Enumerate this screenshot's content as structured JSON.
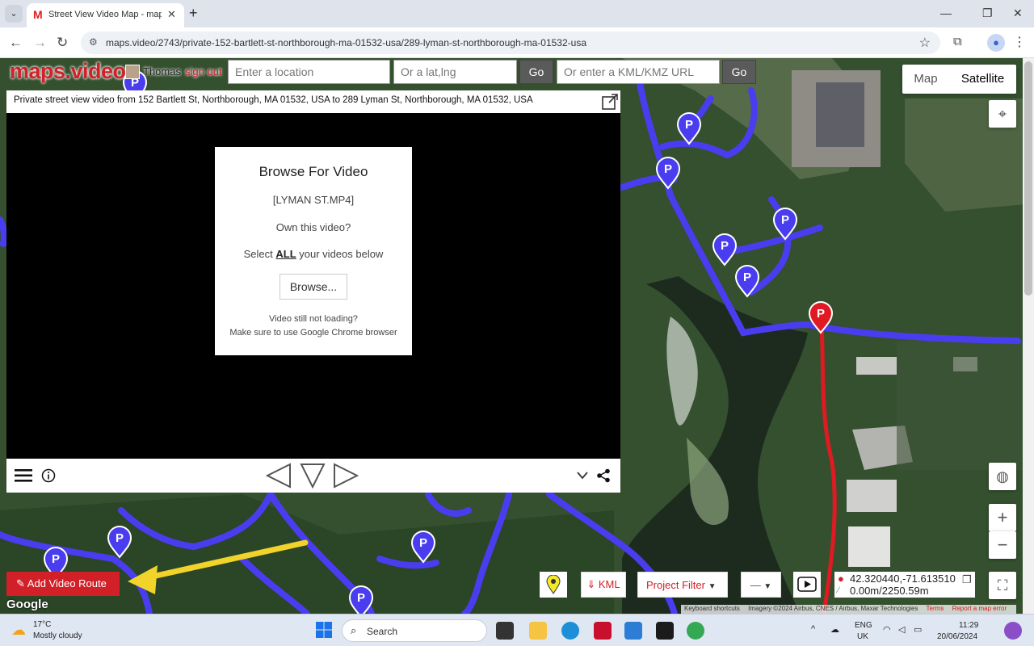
{
  "browser": {
    "tab_title": "Street View Video Map - maps.v",
    "tab_favicon": "M",
    "url": "maps.video/2743/private-152-bartlett-st-northborough-ma-01532-usa/289-lyman-st-northborough-ma-01532-usa"
  },
  "header": {
    "logo": "maps.video",
    "user_name": "Thomas",
    "sign_out": "sign out",
    "location_placeholder": "Enter a location",
    "latlng_placeholder": "Or a lat,lng",
    "go_label": "Go",
    "kml_placeholder": "Or enter a KML/KMZ URL",
    "go2_label": "Go"
  },
  "map_type": {
    "map": "Map",
    "satellite": "Satellite",
    "selected": "Satellite"
  },
  "video": {
    "title": "Private street view video from 152 Bartlett St, Northborough, MA 01532, USA to 289 Lyman St, Northborough, MA 01532, USA",
    "browse": {
      "heading": "Browse For Video",
      "filename": "[LYMAN ST.MP4]",
      "own": "Own this video?",
      "select_prefix": "Select ",
      "select_all": "ALL",
      "select_suffix": " your videos below",
      "button": "Browse...",
      "help1": "Video still not loading?",
      "help2": "Make sure to use Google Chrome browser"
    }
  },
  "tools": {
    "add_route": "Add Video Route",
    "kml": "⇓ KML",
    "project_filter": "Project Filter",
    "dash": "—",
    "coords": "42.320440,-71.613510",
    "distance": "0.00m/2250.59m"
  },
  "map": {
    "google_logo": "Google",
    "attribution": [
      "Keyboard shortcuts",
      "Imagery ©2024 Airbus, CNES / Airbus, Maxar Technologies",
      "Terms",
      "Report a map error"
    ],
    "route_color": "#4a3df0",
    "active_route_color": "#e01a22"
  },
  "taskbar": {
    "weather_temp": "17°C",
    "weather_desc": "Mostly cloudy",
    "search": "Search",
    "lang1": "ENG",
    "lang2": "UK",
    "time": "11:29",
    "date": "20/06/2024"
  }
}
